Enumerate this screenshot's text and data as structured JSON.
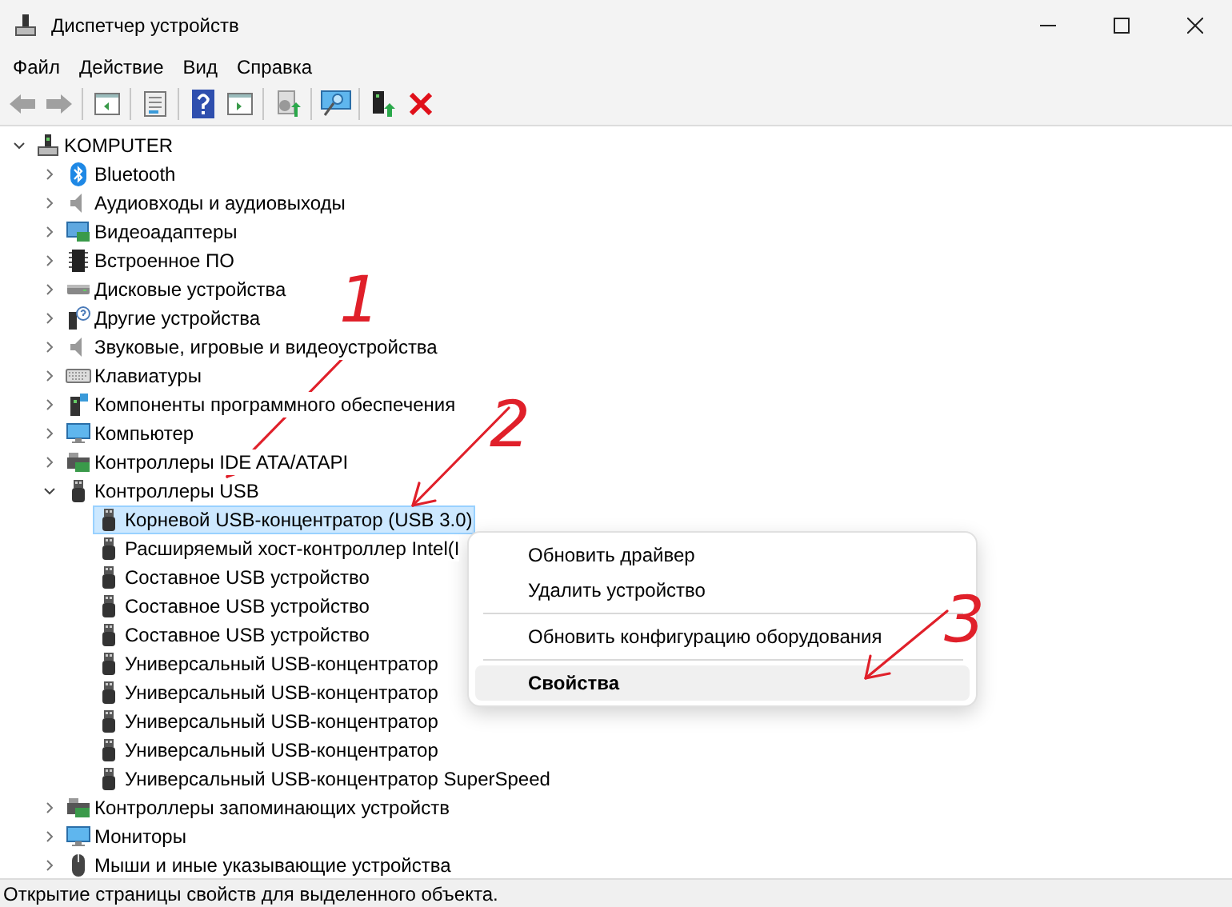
{
  "window": {
    "title": "Диспетчер устройств"
  },
  "menu": [
    "Файл",
    "Действие",
    "Вид",
    "Справка"
  ],
  "toolbar": [
    {
      "kind": "back",
      "disabled": true
    },
    {
      "kind": "forward",
      "disabled": true
    },
    {
      "kind": "sep"
    },
    {
      "kind": "tree"
    },
    {
      "kind": "sep"
    },
    {
      "kind": "props"
    },
    {
      "kind": "sep"
    },
    {
      "kind": "help"
    },
    {
      "kind": "run"
    },
    {
      "kind": "sep"
    },
    {
      "kind": "scan"
    },
    {
      "kind": "sep"
    },
    {
      "kind": "monitor"
    },
    {
      "kind": "sep"
    },
    {
      "kind": "update"
    },
    {
      "kind": "remove"
    }
  ],
  "tree": {
    "label": "KOMPUTER",
    "kind": "computer",
    "expanded": true,
    "selected": false,
    "children": [
      {
        "label": "Bluetooth",
        "kind": "bluetooth",
        "expanded": false,
        "selected": false
      },
      {
        "label": "Аудиовходы и аудиовыходы",
        "kind": "speaker",
        "expanded": false,
        "selected": false
      },
      {
        "label": "Видеоадаптеры",
        "kind": "display",
        "expanded": false,
        "selected": false
      },
      {
        "label": "Встроенное ПО",
        "kind": "chip",
        "expanded": false,
        "selected": false
      },
      {
        "label": "Дисковые устройства",
        "kind": "disk",
        "expanded": false,
        "selected": false
      },
      {
        "label": "Другие устройства",
        "kind": "unknown",
        "expanded": false,
        "selected": false
      },
      {
        "label": "Звуковые, игровые и видеоустройства",
        "kind": "speaker",
        "expanded": false,
        "selected": false
      },
      {
        "label": "Клавиатуры",
        "kind": "keyboard",
        "expanded": false,
        "selected": false
      },
      {
        "label": "Компоненты программного обеспечения",
        "kind": "software",
        "expanded": false,
        "selected": false
      },
      {
        "label": "Компьютер",
        "kind": "monitor",
        "expanded": false,
        "selected": false
      },
      {
        "label": "Контроллеры IDE ATA/ATAPI",
        "kind": "ide",
        "expanded": false,
        "selected": false
      },
      {
        "label": "Контроллеры USB",
        "kind": "usb",
        "expanded": true,
        "selected": false,
        "children": [
          {
            "label": "Корневой USB-концентратор (USB 3.0)",
            "kind": "usb",
            "selected": true
          },
          {
            "label": "Расширяемый хост-контроллер Intel(I",
            "kind": "usb",
            "selected": false
          },
          {
            "label": "Составное USB устройство",
            "kind": "usb",
            "selected": false
          },
          {
            "label": "Составное USB устройство",
            "kind": "usb",
            "selected": false
          },
          {
            "label": "Составное USB устройство",
            "kind": "usb",
            "selected": false
          },
          {
            "label": "Универсальный USB-концентратор",
            "kind": "usb",
            "selected": false
          },
          {
            "label": "Универсальный USB-концентратор",
            "kind": "usb",
            "selected": false
          },
          {
            "label": "Универсальный USB-концентратор",
            "kind": "usb",
            "selected": false
          },
          {
            "label": "Универсальный USB-концентратор",
            "kind": "usb",
            "selected": false
          },
          {
            "label": "Универсальный USB-концентратор SuperSpeed",
            "kind": "usb",
            "selected": false
          }
        ]
      },
      {
        "label": "Контроллеры запоминающих устройств",
        "kind": "ide",
        "expanded": false,
        "selected": false
      },
      {
        "label": "Мониторы",
        "kind": "monitor",
        "expanded": false,
        "selected": false
      },
      {
        "label": "Мыши и иные указывающие устройства",
        "kind": "mouse",
        "expanded": false,
        "selected": false
      }
    ]
  },
  "context_menu": [
    {
      "kind": "item",
      "label": "Обновить драйвер",
      "selected": false
    },
    {
      "kind": "item",
      "label": "Удалить устройство",
      "selected": false
    },
    {
      "kind": "sep"
    },
    {
      "kind": "item",
      "label": "Обновить конфигурацию оборудования",
      "selected": false
    },
    {
      "kind": "sep"
    },
    {
      "kind": "item",
      "label": "Свойства",
      "selected": true
    }
  ],
  "annotations": [
    {
      "label": "1"
    },
    {
      "label": "2"
    },
    {
      "label": "3"
    }
  ],
  "status_bar": "Открытие страницы свойств для выделенного объекта."
}
